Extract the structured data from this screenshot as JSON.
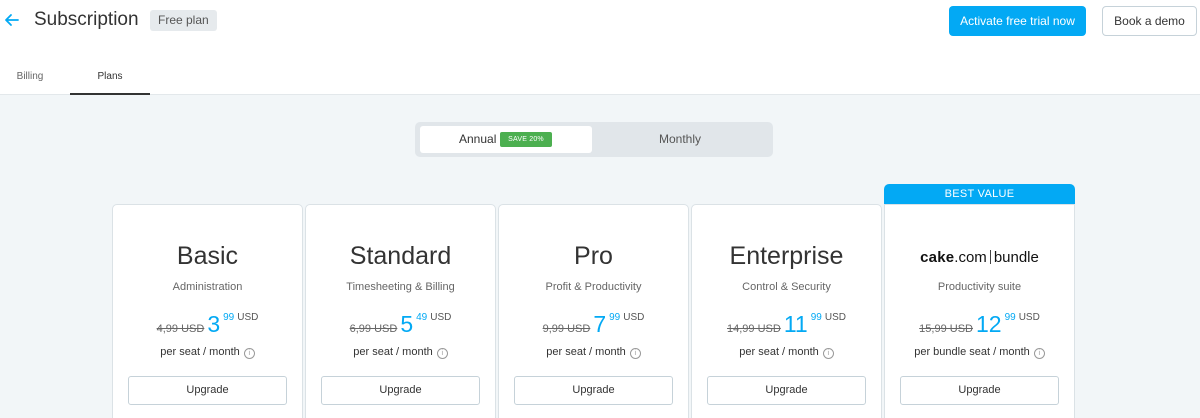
{
  "header": {
    "title": "Subscription",
    "plan_badge": "Free plan",
    "trial_button": "Activate free trial now",
    "demo_button": "Book a demo"
  },
  "tabs": [
    {
      "label": "Billing",
      "active": false
    },
    {
      "label": "Plans",
      "active": true
    }
  ],
  "billing_toggle": {
    "annual_label": "Annual",
    "save_badge": "SAVE 20%",
    "monthly_label": "Monthly",
    "selected": "Annual"
  },
  "best_value_label": "BEST VALUE",
  "plans": [
    {
      "name": "Basic",
      "subtitle": "Administration",
      "old_price": "4,99 USD",
      "price_main": "3",
      "price_cents": "99",
      "currency": "USD",
      "per": "per seat / month",
      "button": "Upgrade"
    },
    {
      "name": "Standard",
      "subtitle": "Timesheeting & Billing",
      "old_price": "6,99 USD",
      "price_main": "5",
      "price_cents": "49",
      "currency": "USD",
      "per": "per seat / month",
      "button": "Upgrade"
    },
    {
      "name": "Pro",
      "subtitle": "Profit & Productivity",
      "old_price": "9,99 USD",
      "price_main": "7",
      "price_cents": "99",
      "currency": "USD",
      "per": "per seat / month",
      "button": "Upgrade"
    },
    {
      "name": "Enterprise",
      "subtitle": "Control & Security",
      "old_price": "14,99 USD",
      "price_main": "11",
      "price_cents": "99",
      "currency": "USD",
      "per": "per seat / month",
      "button": "Upgrade"
    },
    {
      "name_logo_bold": "cake",
      "name_logo_rest": ".com",
      "name_logo_suffix": "bundle",
      "subtitle": "Productivity suite",
      "old_price": "15,99 USD",
      "price_main": "12",
      "price_cents": "99",
      "currency": "USD",
      "per": "per bundle seat / month",
      "button": "Upgrade"
    }
  ],
  "colors": {
    "accent": "#03a9f4",
    "save_badge": "#4caf50",
    "background": "#f2f6f8"
  },
  "icons": {
    "back": "arrow-left-icon",
    "info": "info-circle-icon"
  }
}
